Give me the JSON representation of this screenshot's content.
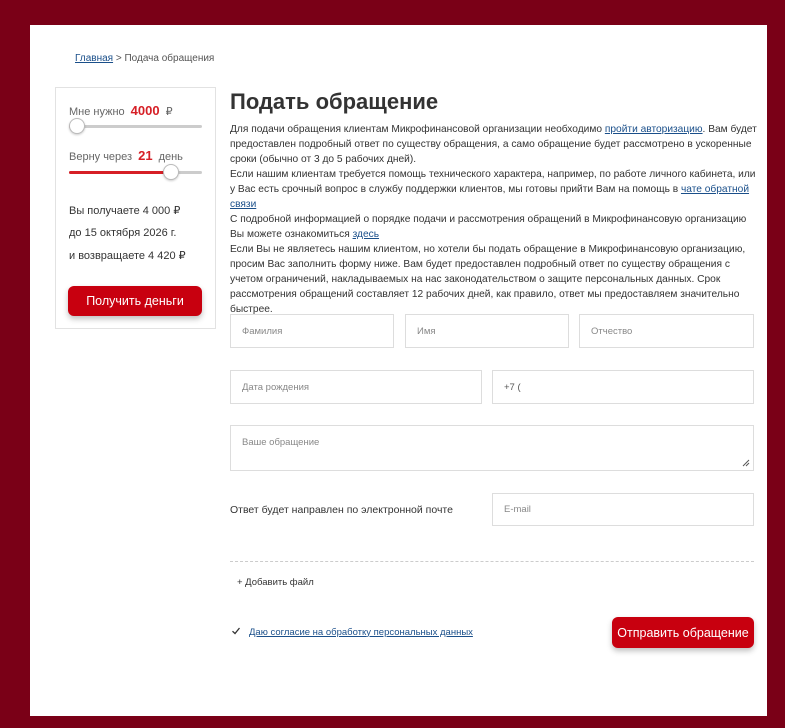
{
  "breadcrumb": {
    "home": "Главная",
    "separator": ">",
    "current": "Подача обращения"
  },
  "calculator": {
    "amount_label": "Мне нужно",
    "amount_value": "4000",
    "amount_unit": "₽",
    "amount_fraction": 0.05,
    "term_label": "Верну через",
    "term_value": "21",
    "term_unit": "день",
    "term_fraction": 0.77,
    "receive_text": "Вы получаете 4 000 ₽",
    "until_text": "до 15 октября 2026 г.",
    "return_text": "и возвращаете 4 420 ₽",
    "button_label": "Получить деньги"
  },
  "page": {
    "title": "Подать обращение",
    "intro": {
      "p1_text": "Для подачи обращения клиентам Микрофинансовой организации необходимо ",
      "p1_link": "пройти авторизацию",
      "p1_tail": ". Вам будет предоставлен подробный ответ по существу обращения, а само обращение будет рассмотрено в ускоренные сроки (обычно от 3 до 5 рабочих дней).",
      "p2_text": "Если нашим клиентам требуется помощь технического характера, например, по работе личного кабинета, или у Вас есть срочный вопрос в службу поддержки клиентов, мы готовы прийти Вам на помощь в ",
      "p2_link": "чате обратной связи",
      "p3_text": "С подробной информацией о порядке подачи и рассмотрения обращений в Микрофинансовую организацию Вы можете ознакомиться ",
      "p3_link": "здесь",
      "p4_text": "Если Вы не являетесь нашим клиентом, но хотели бы подать обращение в Микрофинансовую организацию, просим Вас заполнить форму ниже. Вам будет предоставлен подробный ответ по существу обращения с учетом ограничений, накладываемых на нас законодательством о защите персональных данных. Срок рассмотрения обращений составляет 12 рабочих дней, как правило, ответ мы предоставляем значительно быстрее."
    }
  },
  "form": {
    "last_name_placeholder": "Фамилия",
    "first_name_placeholder": "Имя",
    "middle_name_placeholder": "Отчество",
    "birth_date_placeholder": "Дата рождения",
    "phone_value": "+7 (",
    "message_placeholder": "Ваше обращение",
    "email_label": "Ответ будет направлен по электронной почте",
    "email_placeholder": "E-mail",
    "add_file_label": "+ Добавить файл",
    "consent_label": "Даю согласие на обработку персональных данных",
    "submit_label": "Отправить обращение"
  }
}
